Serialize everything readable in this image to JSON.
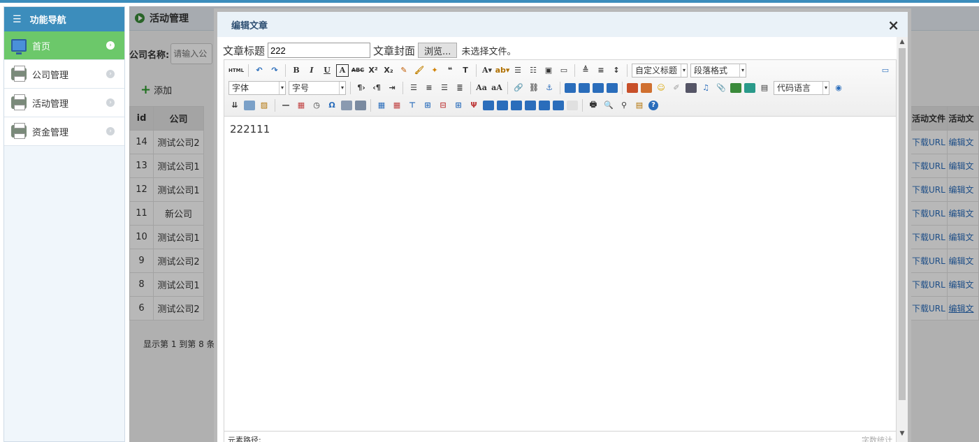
{
  "sidebar": {
    "title": "功能导航",
    "items": [
      {
        "label": "首页",
        "icon": "monitor-icon",
        "active": true
      },
      {
        "label": "公司管理",
        "icon": "printer-icon"
      },
      {
        "label": "活动管理",
        "icon": "printer-icon"
      },
      {
        "label": "资金管理",
        "icon": "printer-icon"
      }
    ]
  },
  "main": {
    "title": "活动管理",
    "search_label": "公司名称:",
    "search_placeholder": "请输入公",
    "add_label": "添加",
    "table": {
      "headers": [
        "id",
        "公司"
      ],
      "rows": [
        [
          "14",
          "测试公司2"
        ],
        [
          "13",
          "测试公司1"
        ],
        [
          "12",
          "测试公司1"
        ],
        [
          "11",
          "新公司"
        ],
        [
          "10",
          "测试公司1"
        ],
        [
          "9",
          "测试公司2"
        ],
        [
          "8",
          "测试公司1"
        ],
        [
          "6",
          "测试公司2"
        ]
      ]
    },
    "right_headers": [
      "活动文件",
      "活动文"
    ],
    "right_cells": [
      "下载URL",
      "编辑文"
    ],
    "footer": "显示第 1 到第 8 条"
  },
  "modal": {
    "title": "编辑文章",
    "close": "×",
    "title_label": "文章标题",
    "title_value": "222",
    "cover_label": "文章封面",
    "browse_label": "浏览...",
    "no_file": "未选择文件。",
    "editor": {
      "toolbar": {
        "custom_heading": "自定义标题",
        "paragraph": "段落格式",
        "font": "字体",
        "font_size": "字号",
        "code_lang": "代码语言"
      },
      "content": "222111",
      "status_path": "元素路径:",
      "word_count": "字数统计"
    }
  },
  "colors": {
    "accent": "#3c8dbc",
    "active": "#6cc86a",
    "link": "#2a6dbb"
  }
}
